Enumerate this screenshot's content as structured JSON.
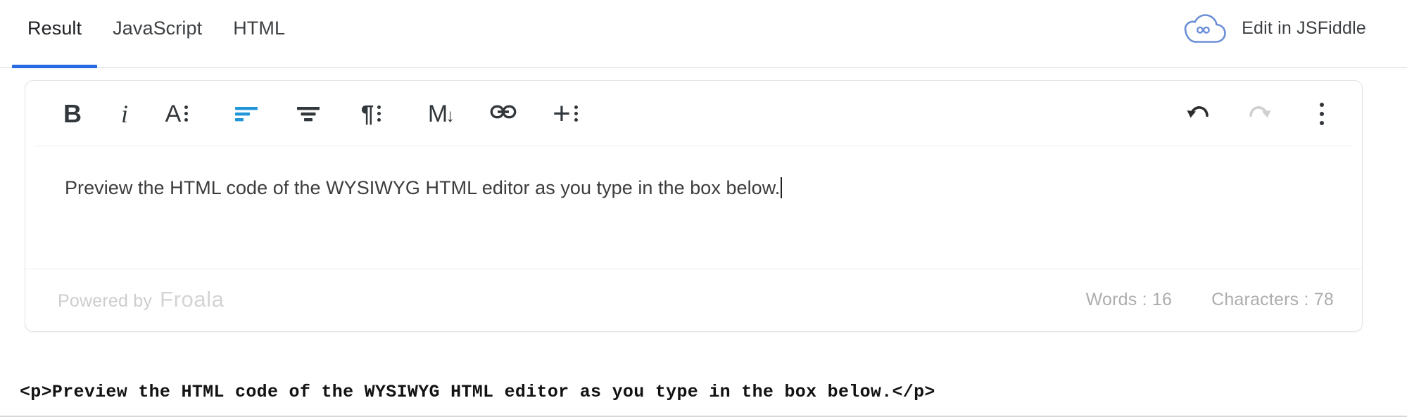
{
  "tabs": [
    {
      "label": "Result",
      "active": true
    },
    {
      "label": "JavaScript",
      "active": false
    },
    {
      "label": "HTML",
      "active": false
    }
  ],
  "jsfiddle": {
    "label": "Edit in JSFiddle",
    "logo_icon": "jsfiddle-cloud-infinity-icon",
    "logo_color": "#6b8fd6"
  },
  "toolbar": {
    "bold": {
      "label": "B",
      "icon": "bold-icon",
      "active": false
    },
    "italic": {
      "label": "i",
      "icon": "italic-icon",
      "active": false
    },
    "more_text": {
      "label": "A",
      "icon": "more-text-icon",
      "active": false
    },
    "align_left": {
      "icon": "align-left-icon",
      "active": true,
      "color": "#2196d9"
    },
    "align_center": {
      "icon": "align-center-icon",
      "active": false
    },
    "paragraph_format": {
      "label": "¶",
      "icon": "paragraph-format-icon",
      "active": false
    },
    "markdown": {
      "label": "M",
      "arrow": "↓",
      "icon": "markdown-icon",
      "active": false
    },
    "insert_link": {
      "icon": "link-icon",
      "active": false
    },
    "more_rich": {
      "label": "+",
      "icon": "more-rich-icon",
      "active": false
    },
    "undo": {
      "icon": "undo-icon",
      "enabled": true
    },
    "redo": {
      "icon": "redo-icon",
      "enabled": false
    },
    "more_menu": {
      "icon": "more-vertical-icon"
    }
  },
  "editor": {
    "content": "Preview the HTML code of the WYSIWYG HTML editor as you type in the box below.",
    "caret_visible": true
  },
  "footer": {
    "powered_by_text": "Powered by",
    "powered_by_brand": "Froala",
    "words_label": "Words : 16",
    "characters_label": "Characters : 78"
  },
  "output": {
    "code": "<p>Preview the HTML code of the WYSIWYG HTML editor as you type in the box below.</p>"
  }
}
